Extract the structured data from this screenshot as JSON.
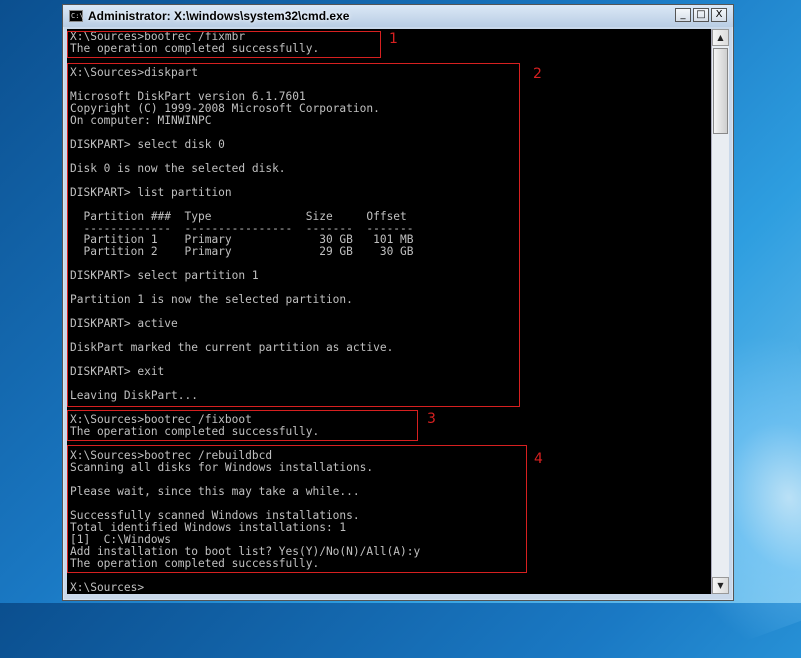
{
  "window": {
    "title": "Administrator: X:\\windows\\system32\\cmd.exe",
    "icon_text": "C:\\",
    "buttons": {
      "minimize": "_",
      "maximize": "□",
      "close": "X"
    }
  },
  "console_lines": [
    "X:\\Sources>bootrec /fixmbr",
    "The operation completed successfully.",
    "",
    "X:\\Sources>diskpart",
    "",
    "Microsoft DiskPart version 6.1.7601",
    "Copyright (C) 1999-2008 Microsoft Corporation.",
    "On computer: MINWINPC",
    "",
    "DISKPART> select disk 0",
    "",
    "Disk 0 is now the selected disk.",
    "",
    "DISKPART> list partition",
    "",
    "  Partition ###  Type              Size     Offset",
    "  -------------  ----------------  -------  -------",
    "  Partition 1    Primary             30 GB   101 MB",
    "  Partition 2    Primary             29 GB    30 GB",
    "",
    "DISKPART> select partition 1",
    "",
    "Partition 1 is now the selected partition.",
    "",
    "DISKPART> active",
    "",
    "DiskPart marked the current partition as active.",
    "",
    "DISKPART> exit",
    "",
    "Leaving DiskPart...",
    "",
    "X:\\Sources>bootrec /fixboot",
    "The operation completed successfully.",
    "",
    "X:\\Sources>bootrec /rebuildbcd",
    "Scanning all disks for Windows installations.",
    "",
    "Please wait, since this may take a while...",
    "",
    "Successfully scanned Windows installations.",
    "Total identified Windows installations: 1",
    "[1]  C:\\Windows",
    "Add installation to boot list? Yes(Y)/No(N)/All(A):y",
    "The operation completed successfully.",
    "",
    "X:\\Sources>"
  ],
  "annotations": [
    {
      "label": "1"
    },
    {
      "label": "2"
    },
    {
      "label": "3"
    },
    {
      "label": "4"
    }
  ],
  "scrollbar": {
    "up_arrow": "▲",
    "down_arrow": "▼"
  }
}
